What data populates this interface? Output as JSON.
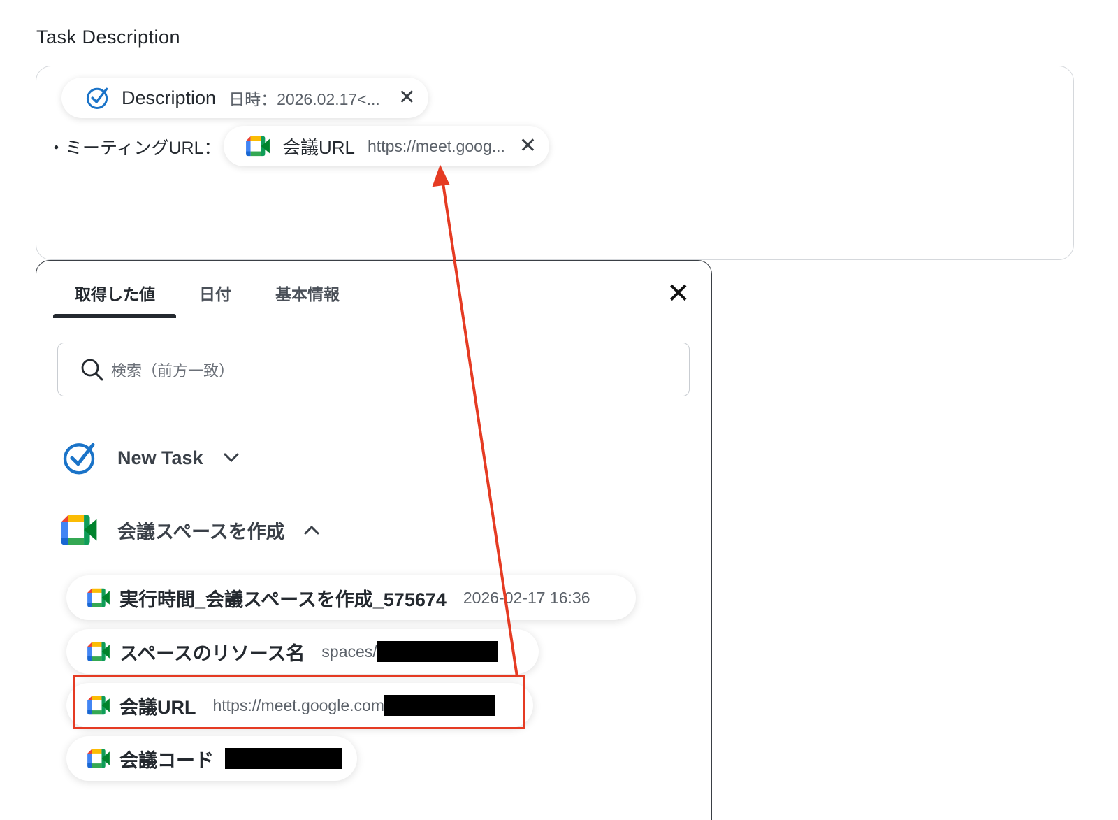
{
  "section": {
    "title": "Task Description"
  },
  "description_field": {
    "token1": {
      "label": "Description",
      "value": "日時：2026.02.17<..."
    },
    "line_prefix": "・ミーティングURL：",
    "token2": {
      "label": "会議URL",
      "value": "https://meet.goog..."
    }
  },
  "popup": {
    "tabs": [
      {
        "label": "取得した値",
        "active": true
      },
      {
        "label": "日付",
        "active": false
      },
      {
        "label": "基本情報",
        "active": false
      }
    ],
    "search": {
      "placeholder": "検索（前方一致）"
    },
    "groups": [
      {
        "name": "New Task",
        "icon": "task-check-icon",
        "expanded": false
      },
      {
        "name": "会議スペースを作成",
        "icon": "google-meet-icon",
        "expanded": true
      }
    ],
    "items": [
      {
        "label": "実行時間_会議スペースを作成_575674",
        "value": "2026-02-17 16:36"
      },
      {
        "label": "スペースのリソース名",
        "value": "spaces/"
      },
      {
        "label": "会議URL",
        "value": "https://meet.google.com"
      },
      {
        "label": "会議コード",
        "value": ""
      }
    ]
  },
  "colors": {
    "highlight": "#e53b23",
    "task_blue": "#1a73c8"
  }
}
